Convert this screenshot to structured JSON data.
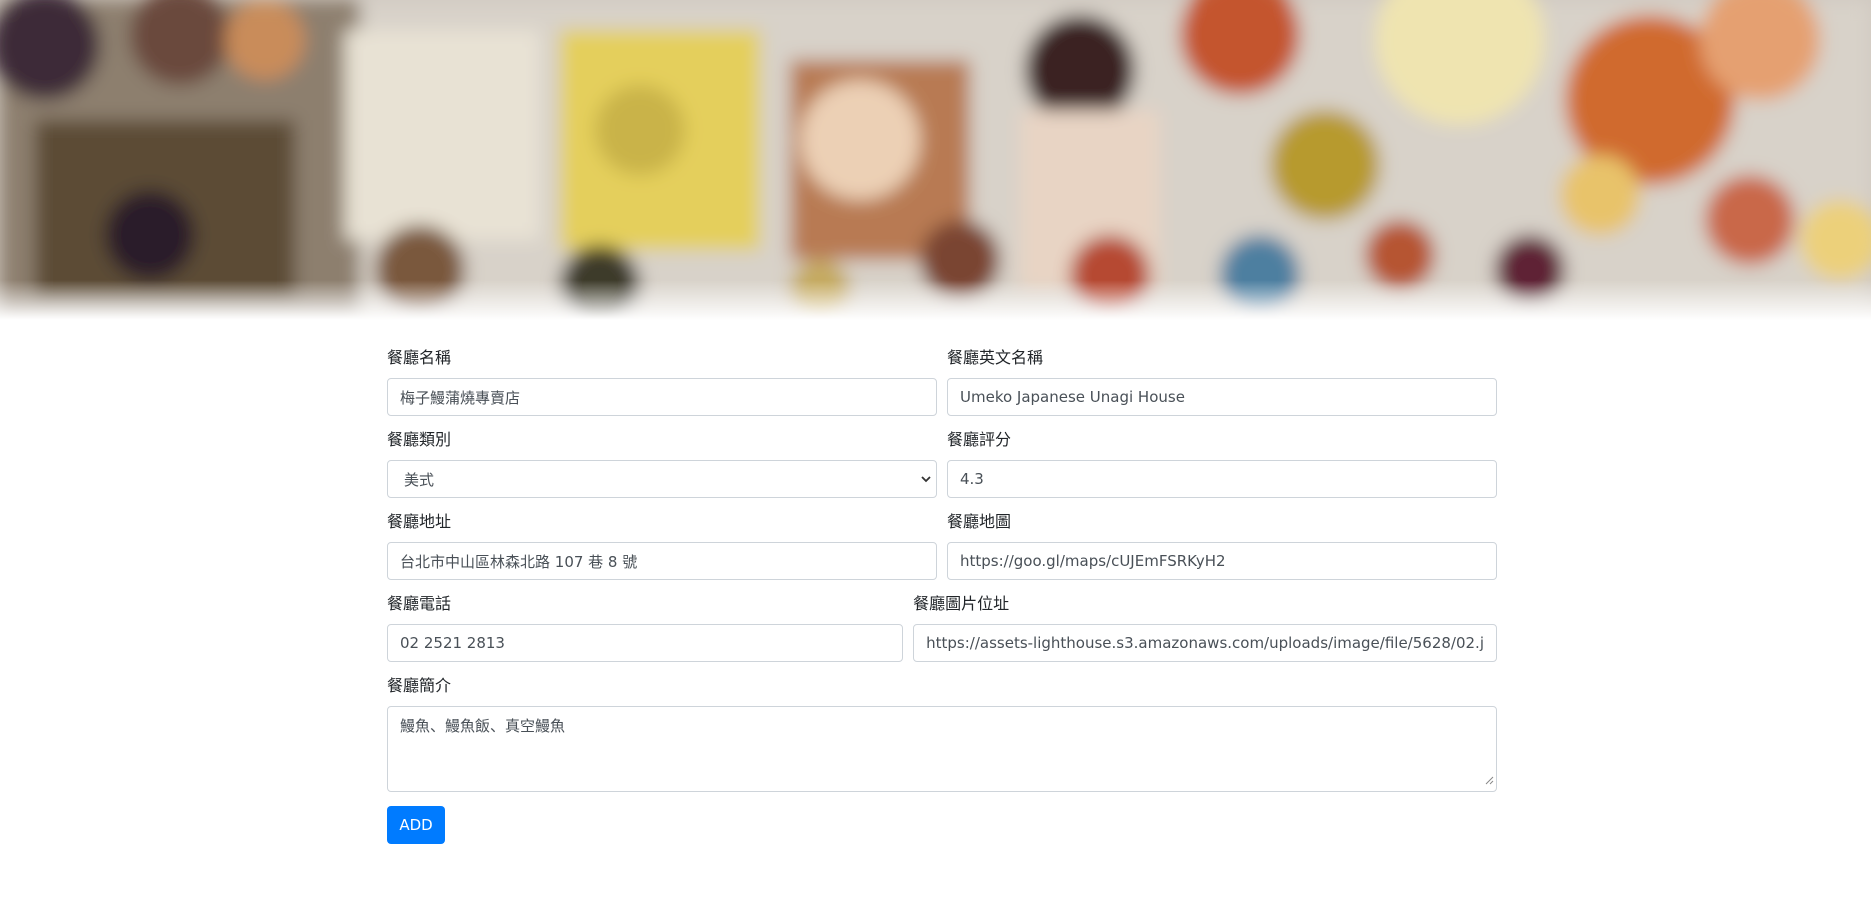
{
  "form": {
    "name_label": "餐廳名稱",
    "name_value": "梅子鰻蒲燒專賣店",
    "name_en_label": "餐廳英文名稱",
    "name_en_value": "Umeko Japanese Unagi House",
    "category_label": "餐廳類別",
    "category_value": "美式",
    "rating_label": "餐廳評分",
    "rating_value": "4.3",
    "location_label": "餐廳地址",
    "location_value": "台北市中山區林森北路 107 巷 8 號",
    "map_label": "餐廳地圖",
    "map_value": "https://goo.gl/maps/cUJEmFSRKyH2",
    "phone_label": "餐廳電話",
    "phone_value": " 02 2521 2813",
    "image_label": "餐廳圖片位址",
    "image_value": "https://assets-lighthouse.s3.amazonaws.com/uploads/image/file/5628/02.j",
    "description_label": "餐廳簡介",
    "description_value": "鰻魚、鰻魚飯、真空鰻魚",
    "submit_label": "ADD"
  },
  "colors": {
    "primary": "#007bff",
    "border": "#ced4da",
    "text": "#212529",
    "input_text": "#495057"
  },
  "icons": [
    "chevron-down-icon",
    "resize-handle-icon"
  ]
}
